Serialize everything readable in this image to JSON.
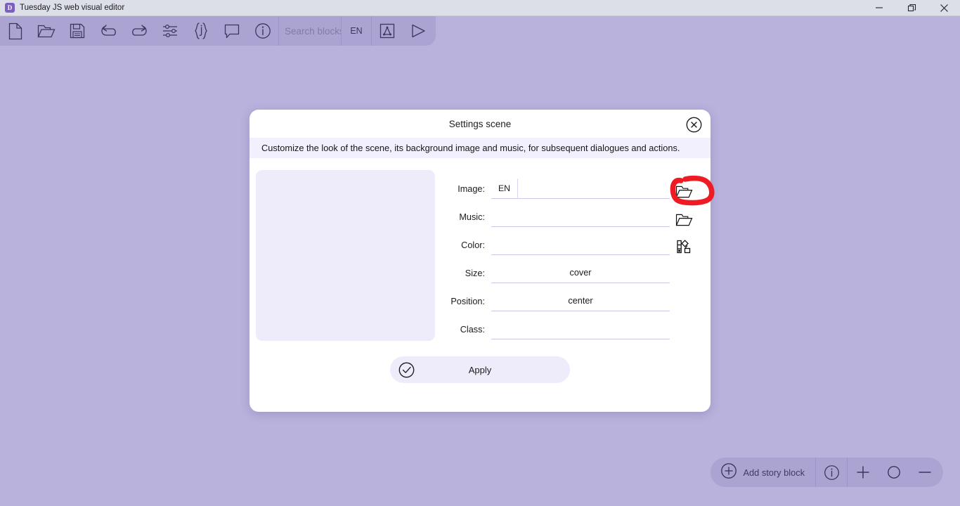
{
  "window": {
    "app_icon": "tuesday-logo-icon",
    "title": "Tuesday JS web visual editor",
    "controls": {
      "minimize": "minimize-icon",
      "maximize": "maximize-icon",
      "close": "close-icon"
    }
  },
  "toolbar": {
    "buttons": [
      {
        "name": "new-file-icon",
        "label": "New"
      },
      {
        "name": "open-folder-icon",
        "label": "Open"
      },
      {
        "name": "save-icon",
        "label": "Save"
      },
      {
        "name": "undo-icon",
        "label": "Undo"
      },
      {
        "name": "redo-icon",
        "label": "Redo"
      },
      {
        "name": "settings-sliders-icon",
        "label": "Settings"
      },
      {
        "name": "json-braces-icon",
        "label": "JSON"
      },
      {
        "name": "comment-icon",
        "label": "Comment"
      },
      {
        "name": "info-icon",
        "label": "Info"
      }
    ],
    "search": {
      "placeholder": "Search blocks",
      "value": ""
    },
    "language": "EN",
    "style_button": "font-style-icon",
    "play_button": "play-icon"
  },
  "dialog": {
    "title": "Settings scene",
    "close_icon": "close-circle-icon",
    "description": "Customize the look of the scene, its background image and music, for subsequent dialogues and actions.",
    "preview": {
      "name": "scene-preview",
      "empty": true
    },
    "fields": [
      {
        "label": "Image:",
        "lang_tab": "EN",
        "value": "",
        "icon": "open-folder-icon",
        "has_lang": true,
        "centered": false,
        "annotated": true
      },
      {
        "label": "Music:",
        "lang_tab": "",
        "value": "",
        "icon": "open-folder-icon",
        "has_lang": false,
        "centered": false,
        "annotated": false
      },
      {
        "label": "Color:",
        "lang_tab": "",
        "value": "",
        "icon": "color-picker-icon",
        "has_lang": false,
        "centered": false,
        "annotated": false
      },
      {
        "label": "Size:",
        "lang_tab": "",
        "value": "cover",
        "icon": "",
        "has_lang": false,
        "centered": true,
        "annotated": false
      },
      {
        "label": "Position:",
        "lang_tab": "",
        "value": "center",
        "icon": "",
        "has_lang": false,
        "centered": true,
        "annotated": false
      },
      {
        "label": "Class:",
        "lang_tab": "",
        "value": "",
        "icon": "",
        "has_lang": false,
        "centered": false,
        "annotated": false
      }
    ],
    "apply": {
      "label": "Apply",
      "icon": "check-circle-icon"
    }
  },
  "annotation": {
    "shape": "hand-drawn-circle",
    "color": "#ee1b24",
    "target": "image-open-folder-button"
  },
  "bottombar": {
    "add_story_block": {
      "label": "Add story block",
      "icon": "plus-circle-icon"
    },
    "info_icon": "info-icon",
    "zoom_in_icon": "plus-icon",
    "reset_icon": "circle-icon",
    "zoom_out_icon": "minus-icon"
  },
  "colors": {
    "canvas": "#b9b2dd",
    "toolbar": "#aba4d2",
    "titlebar": "#dcdfe8",
    "dialog": "#ffffff",
    "panel_light": "#eeebfb",
    "desc_bg": "#f2f0fc",
    "accent_red": "#ee1b24",
    "logo": "#7c5ec1"
  }
}
